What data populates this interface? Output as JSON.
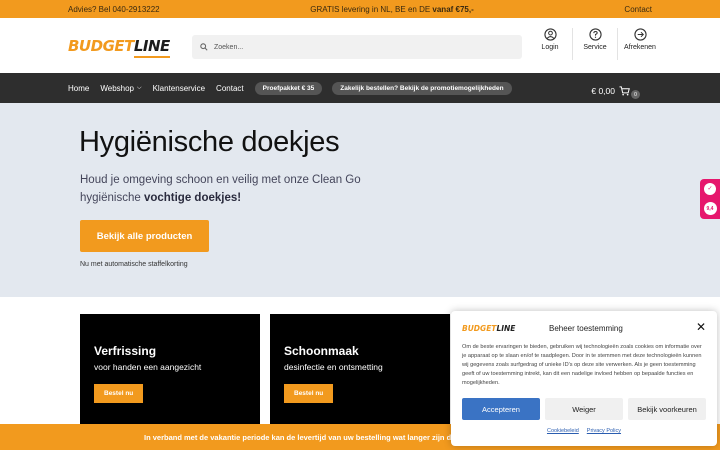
{
  "topbar": {
    "phone": "Advies? Bel 040-2913222",
    "shipping_prefix": "GRATIS levering in NL, BE en DE ",
    "shipping_bold": "vanaf €75,-",
    "contact": "Contact"
  },
  "header": {
    "logo_part1": "BUDGET",
    "logo_part2": "LINE",
    "search_placeholder": "Zoeken...",
    "icons": [
      {
        "label": "Login",
        "icon": "user-icon"
      },
      {
        "label": "Service",
        "icon": "help-icon"
      },
      {
        "label": "Afrekenen",
        "icon": "checkout-arrow-icon"
      }
    ]
  },
  "nav": {
    "items": [
      "Home",
      "Webshop",
      "Klantenservice",
      "Contact"
    ],
    "pill1": "Proefpakket € 35",
    "pill2": "Zakelijk bestellen? Bekijk de promotiemogelijkheden",
    "cart_total": "€ 0,00",
    "cart_count": "0"
  },
  "hero": {
    "title": "Hygiënische doekjes",
    "subtitle_plain": "Houd je omgeving schoon en veilig met onze Clean Go hygiënische ",
    "subtitle_bold": "vochtige doekjes!",
    "button": "Bekijk alle producten",
    "note": "Nu met automatische staffelkorting"
  },
  "cards": [
    {
      "title": "Verfrissing",
      "text": "voor handen een aangezicht",
      "button": "Bestel nu"
    },
    {
      "title": "Schoonmaak",
      "text": "desinfectie en ontsmetting",
      "button": "Bestel nu"
    }
  ],
  "bottombar": "In verband met de vakantie periode kan de levertijd van uw bestelling wat langer zijn dan",
  "sidewidget": {
    "score": "9,4"
  },
  "cookie": {
    "logo_part1": "BUDGET",
    "logo_part2": "LINE",
    "title": "Beheer toestemming",
    "close": "✕",
    "text": "Om de beste ervaringen te bieden, gebruiken wij technologieën zoals cookies om informatie over je apparaat op te slaan en/of te raadplegen. Door in te stemmen met deze technologieën kunnen wij gegevens zoals surfgedrag of unieke ID's op deze site verwerken. Als je geen toestemming geeft of uw toestemming intrekt, kan dit een nadelige invloed hebben op bepaalde functies en mogelijkheden.",
    "accept": "Accepteren",
    "deny": "Weiger",
    "prefs": "Bekijk voorkeuren",
    "link1": "Cookiebeleid",
    "link2": "Privacy Policy"
  },
  "colors": {
    "accent": "#f29a1e",
    "nav_bg": "#2e2e2e",
    "hero_bg": "#e3e8ef",
    "cookie_accept": "#3a73c4"
  }
}
